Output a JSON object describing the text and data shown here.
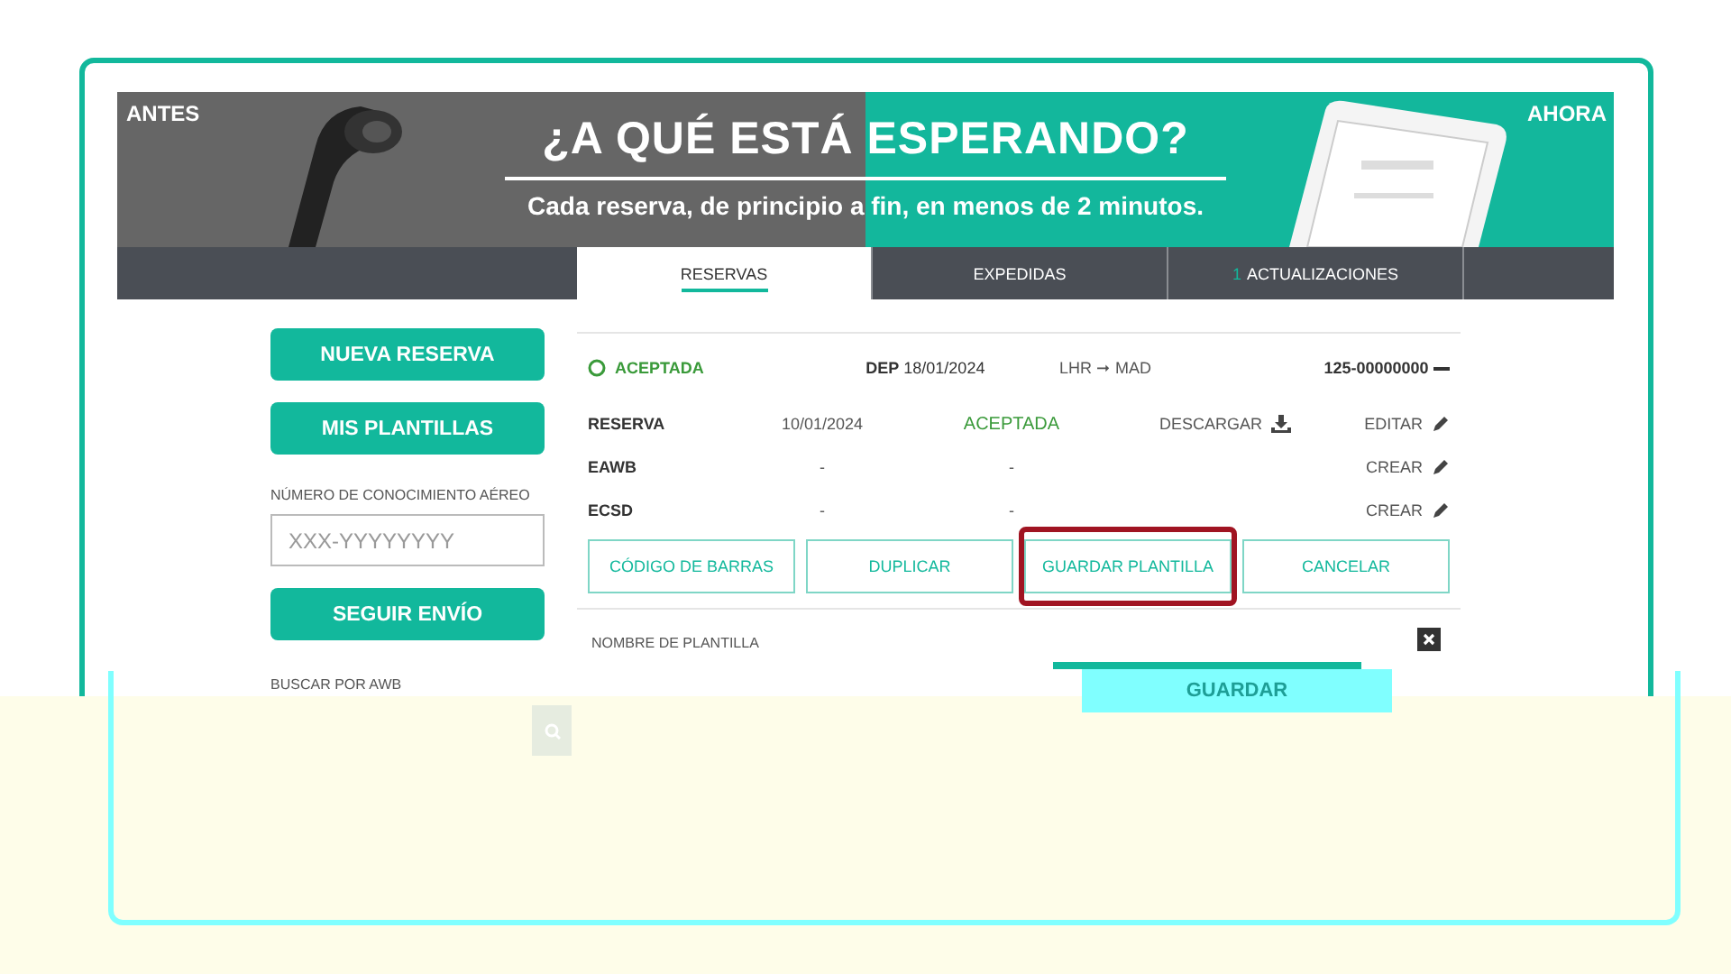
{
  "banner": {
    "left_label": "ANTES",
    "right_label": "AHORA",
    "headline": "¿A QUÉ ESTÁ ESPERANDO?",
    "subtitle": "Cada reserva, de principio a fin, en menos de 2 minutos."
  },
  "tabs": [
    {
      "label": "RESERVAS",
      "selected": true
    },
    {
      "label": "EXPEDIDAS",
      "selected": false
    },
    {
      "label": "ACTUALIZACIONES",
      "count": "1",
      "selected": false
    }
  ],
  "sidebar": {
    "buttons": [
      "NUEVA RESERVA",
      "MIS PLANTILLAS"
    ],
    "awb_label": "NÚMERO DE CONOCIMIENTO AÉREO",
    "awb_placeholder": "XXX-YYYYYYYY",
    "track_button": "SEGUIR ENVÍO",
    "search_label": "BUSCAR POR AWB"
  },
  "booking": {
    "status": "ACEPTADA",
    "dep_label": "DEP",
    "dep_date": "18/01/2024",
    "origin": "LHR",
    "route_arrow": "➞",
    "destination": "MAD",
    "awb": "125-00000000",
    "expanded": true,
    "rows": [
      {
        "label": "RESERVA",
        "date": "10/01/2024",
        "status": "ACEPTADA",
        "download": "DESCARGAR",
        "action": "EDITAR"
      },
      {
        "label": "EAWB",
        "date": "-",
        "status": "-",
        "action": "CREAR"
      },
      {
        "label": "ECSD",
        "date": "-",
        "status": "-",
        "action": "CREAR"
      }
    ],
    "actions": [
      {
        "label": "CÓDIGO DE BARRAS",
        "highlighted": false
      },
      {
        "label": "DUPLICAR",
        "highlighted": false
      },
      {
        "label": "GUARDAR PLANTILLA",
        "highlighted": true
      },
      {
        "label": "CANCELAR",
        "highlighted": false
      }
    ],
    "template_label": "NOMBRE DE PLANTILLA",
    "save_button": "GUARDAR"
  }
}
